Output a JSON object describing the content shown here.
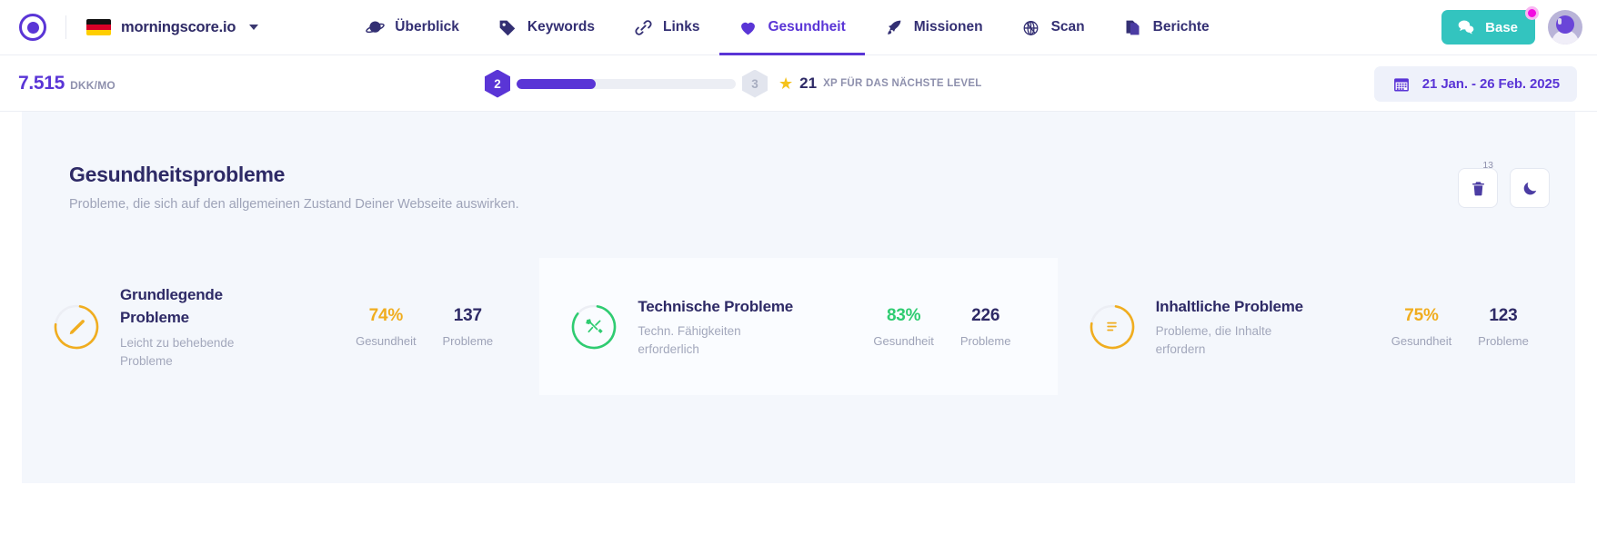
{
  "topbar": {
    "logo_icon": "morningscore-logo-icon",
    "site": {
      "name": "morningscore.io",
      "flag": "de",
      "caret_icon": "chevron-down-icon"
    },
    "nav": [
      {
        "label": "Überblick",
        "icon": "planet-icon",
        "active": false
      },
      {
        "label": "Keywords",
        "icon": "tag-icon",
        "active": false
      },
      {
        "label": "Links",
        "icon": "link-icon",
        "active": false
      },
      {
        "label": "Gesundheit",
        "icon": "heart-icon",
        "active": true
      },
      {
        "label": "Missionen",
        "icon": "rocket-icon",
        "active": false
      },
      {
        "label": "Scan",
        "icon": "target-icon",
        "active": false
      },
      {
        "label": "Berichte",
        "icon": "documents-icon",
        "active": false
      }
    ],
    "base_button": {
      "label": "Base",
      "icon": "chat-bubbles-icon",
      "badge": true
    },
    "avatar": "user-avatar"
  },
  "subbar": {
    "score_value": "7.515",
    "score_unit": "DKK/MO",
    "level_current": "2",
    "level_next": "3",
    "progress_percent": 36,
    "xp_star_icon": "star-icon",
    "xp_value": "21",
    "xp_text": "XP FÜR DAS NÄCHSTE LEVEL",
    "date_range": {
      "icon": "calendar-icon",
      "label": "21 Jan. - 26 Feb. 2025"
    }
  },
  "panel": {
    "title": "Gesundheitsprobleme",
    "subtitle": "Probleme, die sich auf den allgemeinen Zustand Deiner Webseite auswirken.",
    "actions": [
      {
        "name": "trash-button",
        "icon": "trash-icon",
        "badge": "13"
      },
      {
        "name": "snooze-button",
        "icon": "moon-icon",
        "badge": ""
      }
    ]
  },
  "cards": [
    {
      "id": "grundlegende-probleme",
      "icon": "pencil-icon",
      "title": "Grundlegende Probleme",
      "description": "Leicht zu behebende Probleme",
      "health_value": "74%",
      "health_label": "Gesundheit",
      "issues_value": "137",
      "issues_label": "Probleme",
      "color": "#f0ad1f",
      "ring_percent": 74
    },
    {
      "id": "technische-probleme",
      "icon": "tools-icon",
      "title": "Technische Probleme",
      "description": "Techn. Fähigkeiten erforderlich",
      "health_value": "83%",
      "health_label": "Gesundheit",
      "issues_value": "226",
      "issues_label": "Probleme",
      "color": "#2fcc71",
      "ring_percent": 83
    },
    {
      "id": "inhaltliche-probleme",
      "icon": "content-icon",
      "title": "Inhaltliche Probleme",
      "description": "Probleme, die Inhalte erfordern",
      "health_value": "75%",
      "health_label": "Gesundheit",
      "issues_value": "123",
      "issues_label": "Probleme",
      "color": "#f0ad1f",
      "ring_percent": 75
    }
  ]
}
